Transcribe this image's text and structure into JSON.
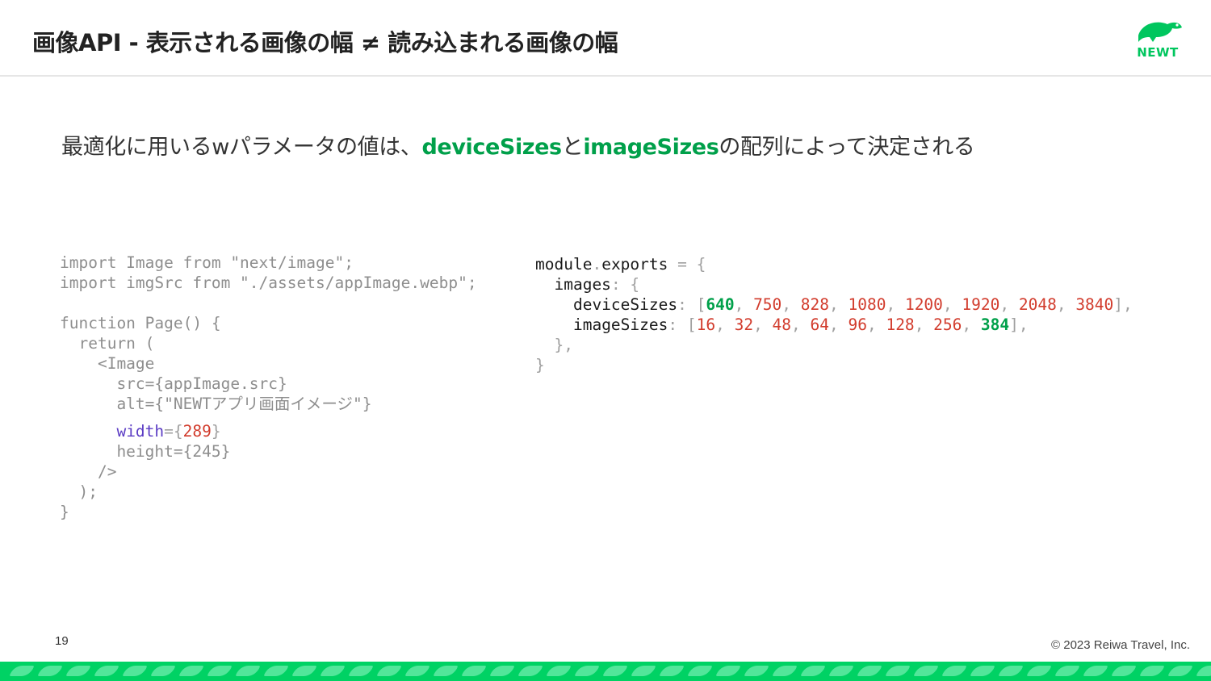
{
  "slide": {
    "title": "画像API - 表示される画像の幅 ≠ 読み込まれる画像の幅",
    "logo_text": "NEWT",
    "subtitle": {
      "part1": "最適化に用いるwパラメータの値は、",
      "hl1": "deviceSizes",
      "part2": "と",
      "hl2": "imageSizes",
      "part3": "の配列によって決定される"
    },
    "page_number": "19",
    "copyright": "© 2023 Reiwa Travel, Inc."
  },
  "code_left": {
    "l1": "import Image from \"next/image\";",
    "l2": "import imgSrc from \"./assets/appImage.webp\";",
    "l3": "function Page() {",
    "l4": "  return (",
    "l5": "    <Image",
    "l6": "      src={appImage.src}",
    "l7": "      alt={\"NEWTアプリ画面イメージ\"}",
    "w_indent": "      ",
    "w_attr": "width",
    "w_eq": "={",
    "w_val": "289",
    "w_close": "}",
    "l9": "      height={245}",
    "l10": "    />",
    "l11": "  );",
    "l12": "}"
  },
  "code_right": {
    "module": "module",
    "dot": ".",
    "exports": "exports",
    "eq_brace": " = {",
    "images": "images",
    "colon_brace": ": {",
    "deviceSizes": "deviceSizes",
    "imageSizes": "imageSizes",
    "colon_bracket": ": [",
    "device_values": [
      "640",
      "750",
      "828",
      "1080",
      "1200",
      "1920",
      "2048",
      "3840"
    ],
    "image_values": [
      "16",
      "32",
      "48",
      "64",
      "96",
      "128",
      "256",
      "384"
    ],
    "sep": ", ",
    "end_array": "],",
    "close_inner": "},",
    "close_outer": "}"
  },
  "colors": {
    "accent_green": "#00a04a",
    "brand_green": "#00d264",
    "number_red": "#d23c2d",
    "keyword_purple": "#5b3cc4"
  }
}
